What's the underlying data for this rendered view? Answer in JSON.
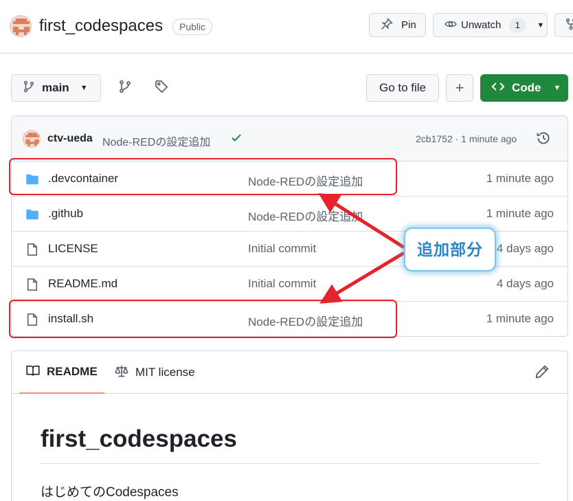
{
  "header": {
    "repo_name": "first_codespaces",
    "visibility": "Public",
    "pin_label": "Pin",
    "watch_label": "Unwatch",
    "watch_count": "1"
  },
  "toolbar": {
    "branch": "main",
    "goto_label": "Go to file",
    "add_label": "+",
    "code_label": "Code"
  },
  "commit": {
    "author": "ctv-ueda",
    "message": "Node-REDの設定追加",
    "meta": "2cb1752 · 1 minute ago"
  },
  "files": [
    {
      "name": ".devcontainer",
      "type": "folder",
      "commit": "Node-REDの設定追加",
      "age": "1 minute ago"
    },
    {
      "name": ".github",
      "type": "folder",
      "commit": "Node-REDの設定追加",
      "age": "1 minute ago"
    },
    {
      "name": "LICENSE",
      "type": "file",
      "commit": "Initial commit",
      "age": "4 days ago"
    },
    {
      "name": "README.md",
      "type": "file",
      "commit": "Initial commit",
      "age": "4 days ago"
    },
    {
      "name": "install.sh",
      "type": "file",
      "commit": "Node-REDの設定追加",
      "age": "1 minute ago"
    }
  ],
  "readme": {
    "tab_readme": "README",
    "tab_license": "MIT license",
    "title": "first_codespaces",
    "description": "はじめてのCodespaces"
  },
  "annotation": {
    "callout": "追加部分",
    "color": "#e6232a",
    "callout_border": "#7cc4e8"
  },
  "colors": {
    "accent_green": "#1f883d",
    "folder_blue": "#54aeff",
    "muted_text": "#59636e",
    "tab_underline": "#fd8c73"
  }
}
